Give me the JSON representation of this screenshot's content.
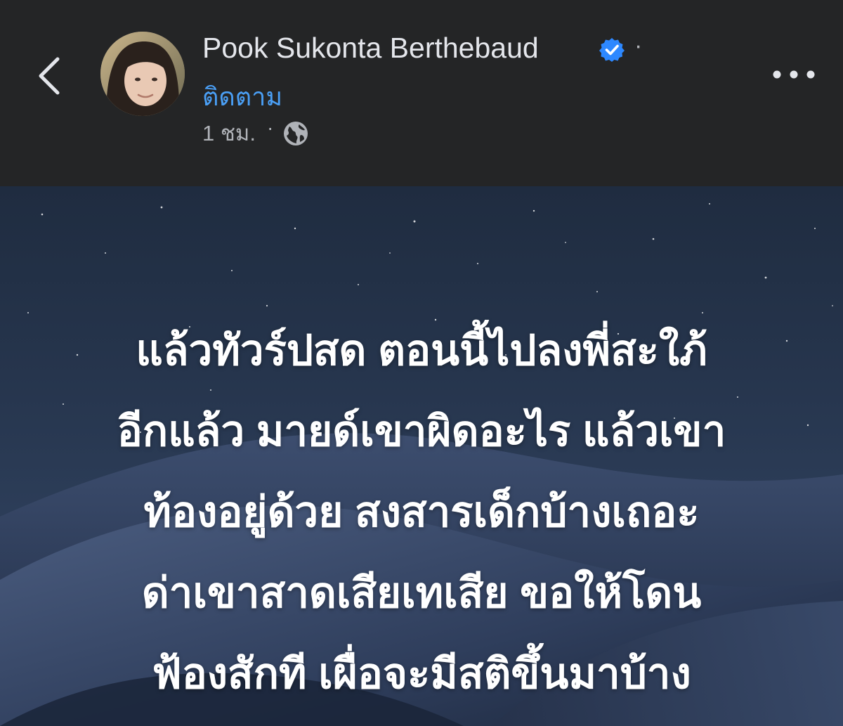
{
  "header": {
    "author_name": "Pook Sukonta Berthebaud",
    "name_separator": "·",
    "follow_label": "ติดตาม",
    "timestamp": "1 ชม.",
    "meta_separator": "·",
    "privacy_icon": "globe-icon",
    "back_icon": "chevron-left-icon",
    "more_icon": "more-horizontal-icon",
    "verified_icon": "verified-badge-icon"
  },
  "post": {
    "lines": [
      "แล้วทัวร์ปสด ตอนนี้ไปลงพี่สะใภ้",
      "อีกแล้ว มายด์เขาผิดอะไร แล้วเขา",
      "ท้องอยู่ด้วย สงสารเด็กบ้างเถอะ",
      "ด่าเขาสาดเสียเทเสีย ขอให้โดน",
      "ฟ้องสักที เผื่อจะมีสติขึ้นมาบ้าง"
    ]
  },
  "colors": {
    "header_bg": "#242526",
    "name_text": "#e4e6eb",
    "follow_text": "#4a9ff5",
    "meta_text": "#b0b3b8",
    "verified_badge": "#2d88ff",
    "post_text": "#ffffff"
  }
}
